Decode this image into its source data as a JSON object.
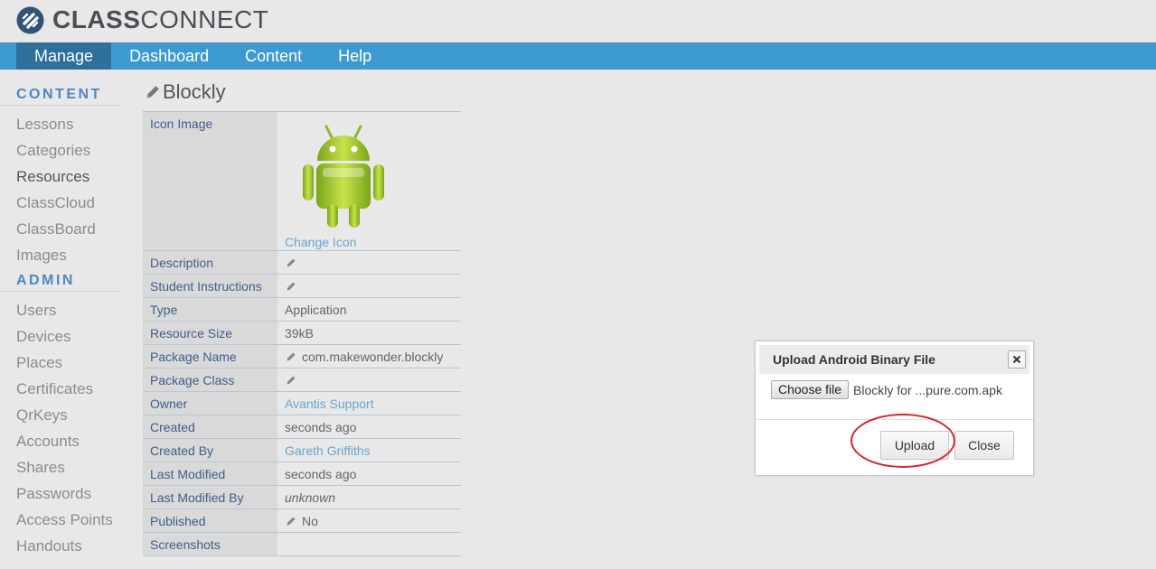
{
  "app": {
    "logo_bold": "CLASS",
    "logo_light": "CONNECT"
  },
  "nav": [
    "Manage",
    "Dashboard",
    "Content",
    "Help"
  ],
  "sidebar": {
    "content_heading": "CONTENT",
    "content_items": [
      "Lessons",
      "Categories",
      "Resources",
      "ClassCloud",
      "ClassBoard",
      "Images"
    ],
    "admin_heading": "ADMIN",
    "admin_items": [
      "Users",
      "Devices",
      "Places",
      "Certificates",
      "QrKeys",
      "Accounts",
      "Shares",
      "Passwords",
      "Access Points",
      "Handouts"
    ]
  },
  "resource": {
    "title": "Blockly",
    "icon_label": "Icon Image",
    "change_icon": "Change Icon",
    "rows": {
      "description": {
        "label": "Description"
      },
      "student_instructions": {
        "label": "Student Instructions"
      },
      "type": {
        "label": "Type",
        "value": "Application"
      },
      "resource_size": {
        "label": "Resource Size",
        "value": "39kB"
      },
      "package_name": {
        "label": "Package Name",
        "value": "com.makewonder.blockly"
      },
      "package_class": {
        "label": "Package Class"
      },
      "owner": {
        "label": "Owner",
        "value": "Avantis Support"
      },
      "created": {
        "label": "Created",
        "value": "seconds ago"
      },
      "created_by": {
        "label": "Created By",
        "value": "Gareth Griffiths"
      },
      "last_modified": {
        "label": "Last Modified",
        "value": "seconds ago"
      },
      "last_modified_by": {
        "label": "Last Modified By",
        "value": "unknown"
      },
      "published": {
        "label": "Published",
        "value": "No"
      },
      "screenshots": {
        "label": "Screenshots"
      }
    }
  },
  "dialog": {
    "title": "Upload Android Binary File",
    "choose_file": "Choose file",
    "file_name": "Blockly for ...pure.com.apk",
    "upload": "Upload",
    "close": "Close"
  },
  "colors": {
    "nav": "#3d9ad1",
    "nav_active": "#2e6f9c",
    "heading": "#4f86c6",
    "link": "#6aa5cf",
    "annotation": "#d9242c"
  }
}
